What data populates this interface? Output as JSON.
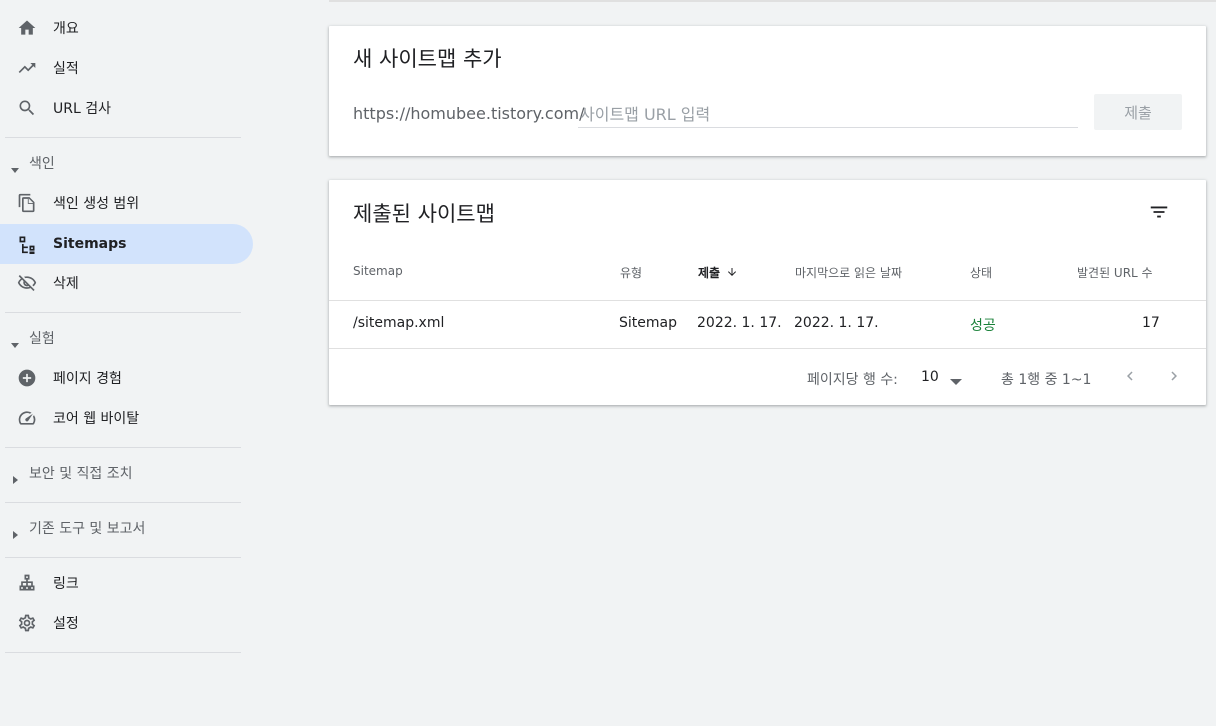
{
  "sidebar": {
    "items": [
      {
        "label": "개요",
        "icon": "home-icon"
      },
      {
        "label": "실적",
        "icon": "trending-up-icon"
      },
      {
        "label": "URL 검사",
        "icon": "search-icon"
      },
      {
        "label": "색인 생성 범위",
        "icon": "copy-pages-icon"
      },
      {
        "label": "Sitemaps",
        "icon": "sitemap-icon",
        "active": true
      },
      {
        "label": "삭제",
        "icon": "eye-off-icon"
      },
      {
        "label": "페이지 경험",
        "icon": "plus-circle-icon"
      },
      {
        "label": "코어 웹 바이탈",
        "icon": "speedometer-icon"
      },
      {
        "label": "링크",
        "icon": "links-icon"
      },
      {
        "label": "설정",
        "icon": "gear-icon"
      }
    ],
    "sections": [
      {
        "label": "색인",
        "expanded": true
      },
      {
        "label": "실험",
        "expanded": true
      },
      {
        "label": "보안 및 직접 조치",
        "expanded": false
      },
      {
        "label": "기존 도구 및 보고서",
        "expanded": false
      }
    ]
  },
  "add_card": {
    "title": "새 사이트맵 추가",
    "prefix": "https://homubee.tistory.com/",
    "input_placeholder": "사이트맵 URL 입력",
    "input_value": "",
    "submit_label": "제출"
  },
  "submitted_card": {
    "title": "제출된 사이트맵",
    "columns": [
      "Sitemap",
      "유형",
      "제출",
      "마지막으로 읽은 날짜",
      "상태",
      "발견된 URL 수"
    ],
    "sorted_column": "제출",
    "rows": [
      {
        "sitemap": "/sitemap.xml",
        "type": "Sitemap",
        "submitted": "2022. 1. 17.",
        "last_read": "2022. 1. 17.",
        "status": "성공",
        "urls": "17"
      }
    ],
    "footer": {
      "rows_per_page_label": "페이지당 행 수:",
      "rows_per_page_value": "10",
      "range_text": "총 1행 중 1~1"
    }
  },
  "colors": {
    "accent_active": "#d2e3fc",
    "status_success": "#188038"
  }
}
